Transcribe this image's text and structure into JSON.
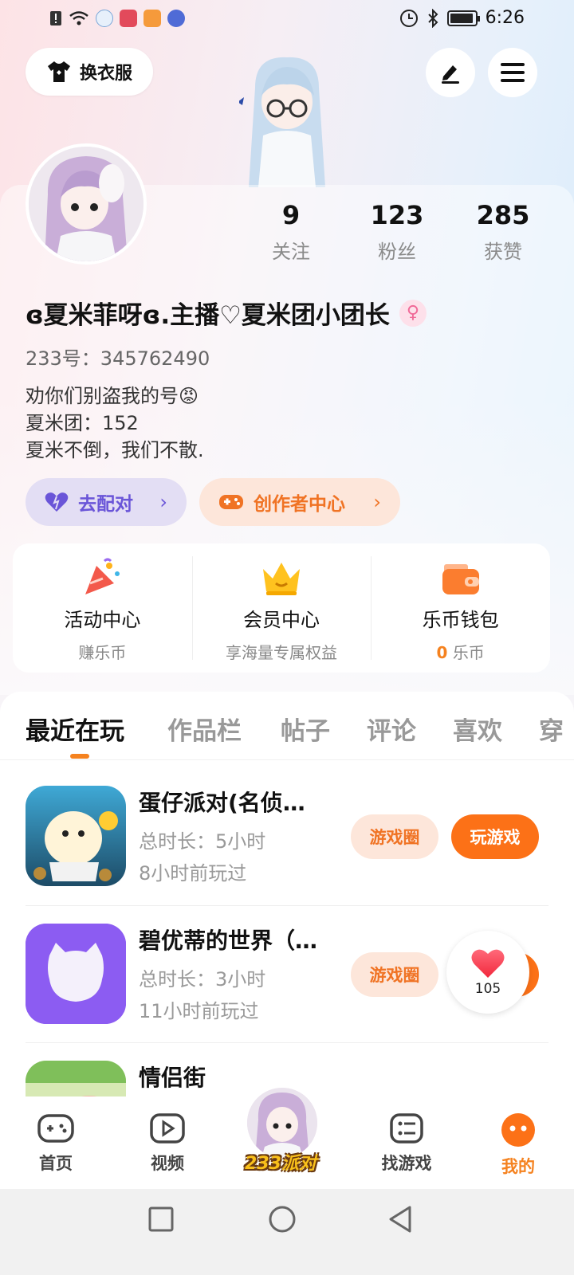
{
  "status_bar": {
    "time": "6:26"
  },
  "header": {
    "outfit_label": "换衣服"
  },
  "profile": {
    "stats": [
      {
        "value": "9",
        "label": "关注"
      },
      {
        "value": "123",
        "label": "粉丝"
      },
      {
        "value": "285",
        "label": "获赞"
      }
    ],
    "nickname": "ɞ夏米菲呀ɞ.主播♡夏米团小团长",
    "gender_symbol": "♀",
    "uid": "233号：345762490",
    "bio_line1": "劝你们别盗我的号😡",
    "bio_line2": "夏米团：152",
    "bio_line3": "夏米不倒，我们不散.",
    "match_label": "去配对",
    "creator_label": "创作者中心"
  },
  "services": [
    {
      "title": "活动中心",
      "sub": "赚乐币"
    },
    {
      "title": "会员中心",
      "sub": "享海量专属权益"
    },
    {
      "title": "乐币钱包",
      "coins": "0",
      "sub": "乐币"
    }
  ],
  "tabs": [
    "最近在玩",
    "作品栏",
    "帖子",
    "评论",
    "喜欢",
    "穿"
  ],
  "games": [
    {
      "name": "蛋仔派对(名侦…",
      "duration": "总时长：5小时",
      "last_played": "8小时前玩过",
      "circle_label": "游戏圈",
      "play_label": "玩游戏"
    },
    {
      "name": "碧优蒂的世界（…",
      "duration": "总时长：3小时",
      "last_played": "11小时前玩过",
      "circle_label": "游戏圈"
    },
    {
      "name": "情侣街"
    }
  ],
  "favorite": {
    "count": "105"
  },
  "bottom_nav": {
    "items": [
      "首页",
      "视频",
      "找游戏",
      "我的"
    ],
    "center_brand": "233派对"
  },
  "colors": {
    "accent": "#f5821f",
    "purple": "#6a55d8"
  }
}
